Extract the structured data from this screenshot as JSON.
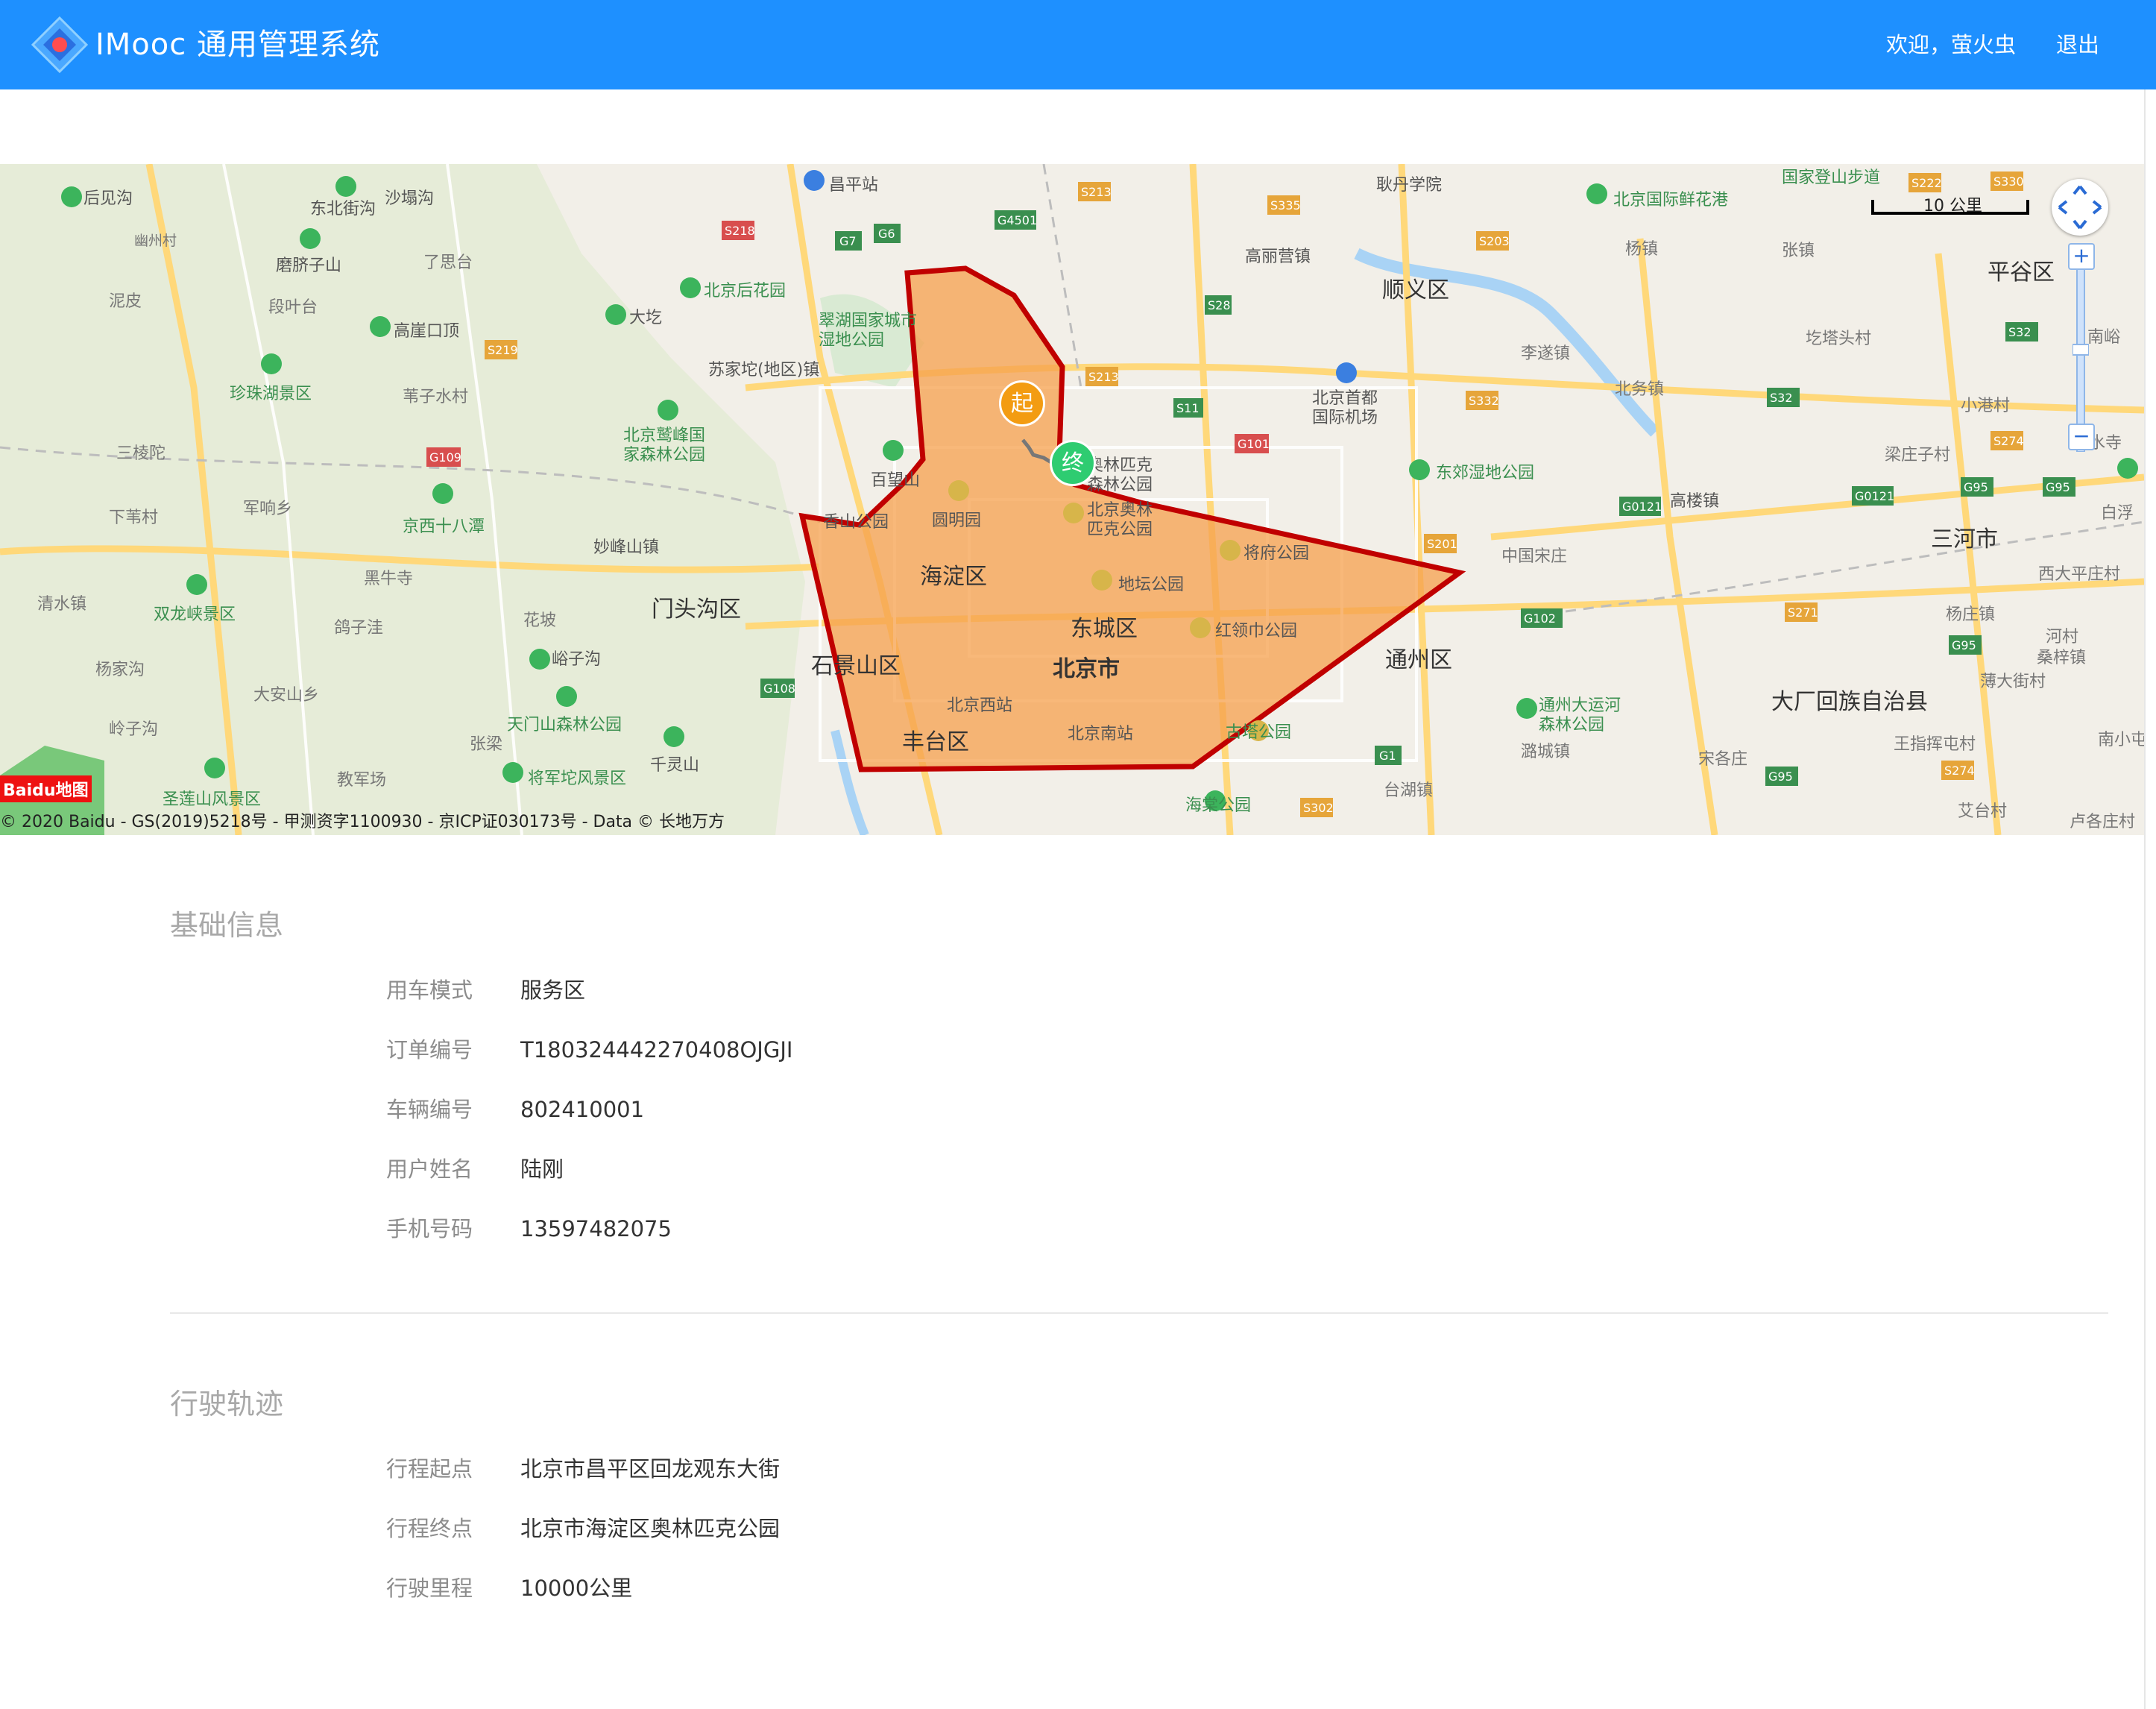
{
  "header": {
    "brand": "IMooc 通用管理系统",
    "welcome": "欢迎，萤火虫",
    "logout": "退出",
    "bg_color": "#1e90ff",
    "logo_icon": "diamond-logo-icon"
  },
  "map": {
    "scale_label": "10 公里",
    "copyright": "© 2020 Baidu - GS(2019)5218号 - 甲测资字1100930 - 京ICP证030173号 - Data © 长地万方",
    "brand_logo": "Baidu地图",
    "start_marker": "起",
    "end_marker": "终",
    "polygon_fill": "#f5a04d",
    "polygon_stroke": "#c00000",
    "labels": [
      {
        "text": "后见沟"
      },
      {
        "text": "东北街沟"
      },
      {
        "text": "沙塌沟"
      },
      {
        "text": "幽州村"
      },
      {
        "text": "磨脐子山"
      },
      {
        "text": "了思台"
      },
      {
        "text": "泥皮"
      },
      {
        "text": "段叶台"
      },
      {
        "text": "高崖口顶"
      },
      {
        "text": "大圪"
      },
      {
        "text": "北京后花园"
      },
      {
        "text": "翠湖国家城市湿地公园"
      },
      {
        "text": "苏家坨(地区)镇"
      },
      {
        "text": "珍珠湖景区"
      },
      {
        "text": "苇子水村"
      },
      {
        "text": "北京鹫峰国家森林公园"
      },
      {
        "text": "三棱陀"
      },
      {
        "text": "百望山"
      },
      {
        "text": "军响乡"
      },
      {
        "text": "京西十八潭"
      },
      {
        "text": "下苇村"
      },
      {
        "text": "香山公园"
      },
      {
        "text": "圆明园"
      },
      {
        "text": "妙峰山镇"
      },
      {
        "text": "海淀区"
      },
      {
        "text": "黑牛寺"
      },
      {
        "text": "清水镇"
      },
      {
        "text": "双龙峡景区"
      },
      {
        "text": "门头沟区"
      },
      {
        "text": "花坡"
      },
      {
        "text": "鸽子洼"
      },
      {
        "text": "峪子沟"
      },
      {
        "text": "杨家沟"
      },
      {
        "text": "大安山乡"
      },
      {
        "text": "石景山区"
      },
      {
        "text": "天门山森林公园"
      },
      {
        "text": "岭子沟"
      },
      {
        "text": "张梁"
      },
      {
        "text": "千灵山"
      },
      {
        "text": "将军坨风景区"
      },
      {
        "text": "教军场"
      },
      {
        "text": "圣莲山风景区"
      },
      {
        "text": "北京西站"
      },
      {
        "text": "丰台区"
      },
      {
        "text": "北京南站"
      },
      {
        "text": "北京市"
      },
      {
        "text": "东城区"
      },
      {
        "text": "地坛公园"
      },
      {
        "text": "红领巾公园"
      },
      {
        "text": "将府公园"
      },
      {
        "text": "奥林匹克森林公园"
      },
      {
        "text": "北京奥林匹克公园"
      },
      {
        "text": "昌平站"
      },
      {
        "text": "北京工业大学耿丹学院"
      },
      {
        "text": "高丽营镇"
      },
      {
        "text": "顺义区"
      },
      {
        "text": "北京首都国际机场"
      },
      {
        "text": "李遂镇"
      },
      {
        "text": "北务镇"
      },
      {
        "text": "杨镇"
      },
      {
        "text": "张镇"
      },
      {
        "text": "北京国际鲜花港"
      },
      {
        "text": "国家登山步道"
      },
      {
        "text": "平谷区"
      },
      {
        "text": "圪塔头村"
      },
      {
        "text": "南峪"
      },
      {
        "text": "小港村"
      },
      {
        "text": "梁庄子村"
      },
      {
        "text": "高楼镇"
      },
      {
        "text": "东郊湿地公园"
      },
      {
        "text": "中国宋庄"
      },
      {
        "text": "三河市"
      },
      {
        "text": "西大平庄村"
      },
      {
        "text": "杨庄镇"
      },
      {
        "text": "河村桑梓镇"
      },
      {
        "text": "通州区"
      },
      {
        "text": "大厂回族自治县"
      },
      {
        "text": "薄大街村"
      },
      {
        "text": "通州大运河森林公园"
      },
      {
        "text": "潞城镇"
      },
      {
        "text": "宋各庄"
      },
      {
        "text": "王指挥屯村"
      },
      {
        "text": "南小屯村"
      },
      {
        "text": "台湖镇"
      },
      {
        "text": "海棠公园"
      },
      {
        "text": "古塔公园"
      },
      {
        "text": "艾台村"
      },
      {
        "text": "卢各庄村"
      },
      {
        "text": "山水寺"
      },
      {
        "text": "白浮"
      }
    ]
  },
  "basic": {
    "title": "基础信息",
    "rows": [
      {
        "label": "用车模式",
        "value": "服务区"
      },
      {
        "label": "订单编号",
        "value": "T180324442270408OJGJI"
      },
      {
        "label": "车辆编号",
        "value": "802410001"
      },
      {
        "label": "用户姓名",
        "value": "陆刚"
      },
      {
        "label": "手机号码",
        "value": "13597482075"
      }
    ]
  },
  "trip": {
    "title": "行驶轨迹",
    "rows": [
      {
        "label": "行程起点",
        "value": "北京市昌平区回龙观东大街"
      },
      {
        "label": "行程终点",
        "value": "北京市海淀区奥林匹克公园"
      },
      {
        "label": "行驶里程",
        "value": "10000公里"
      }
    ]
  }
}
